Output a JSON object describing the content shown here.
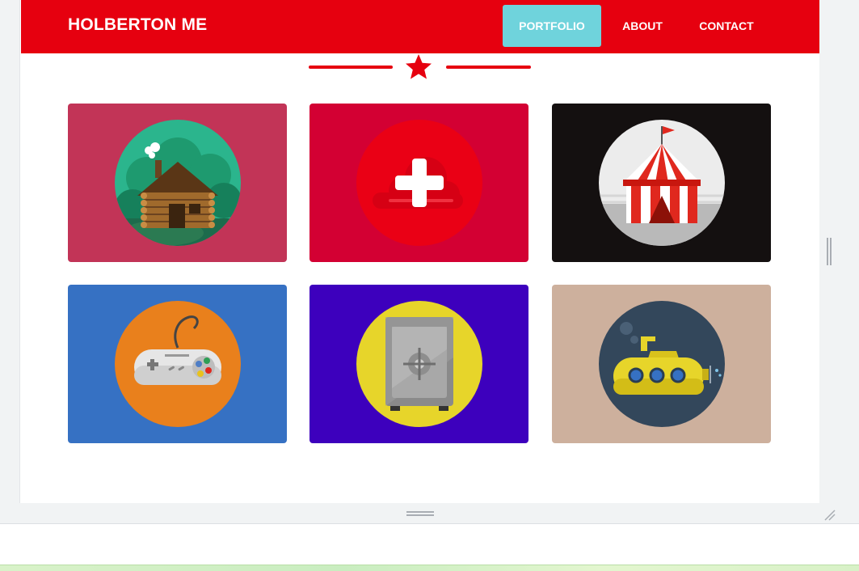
{
  "navbar": {
    "brand": "HOLBERTON ME",
    "links": [
      {
        "label": "PORTFOLIO",
        "active": true
      },
      {
        "label": "ABOUT",
        "active": false
      },
      {
        "label": "CONTACT",
        "active": false
      }
    ]
  },
  "colors": {
    "primary": "#e6000f",
    "active_link": "#6fd3dc",
    "frame": "#f1f3f4"
  },
  "divider_icon": "star-icon",
  "portfolio": [
    {
      "icon": "log-cabin-icon",
      "tile_color": "#c23457",
      "circle_color": "#2bb58d"
    },
    {
      "icon": "plus-cloud-icon",
      "tile_color": "#d30033",
      "circle_color": "#ea0015"
    },
    {
      "icon": "circus-tent-icon",
      "tile_color": "#141010",
      "circle_color": "#ececec"
    },
    {
      "icon": "gamepad-icon",
      "tile_color": "#3671c3",
      "circle_color": "#e9801c"
    },
    {
      "icon": "safe-icon",
      "tile_color": "#3d00bd",
      "circle_color": "#e7d52a"
    },
    {
      "icon": "submarine-icon",
      "tile_color": "#cdb09d",
      "circle_color": "#33475b"
    }
  ]
}
